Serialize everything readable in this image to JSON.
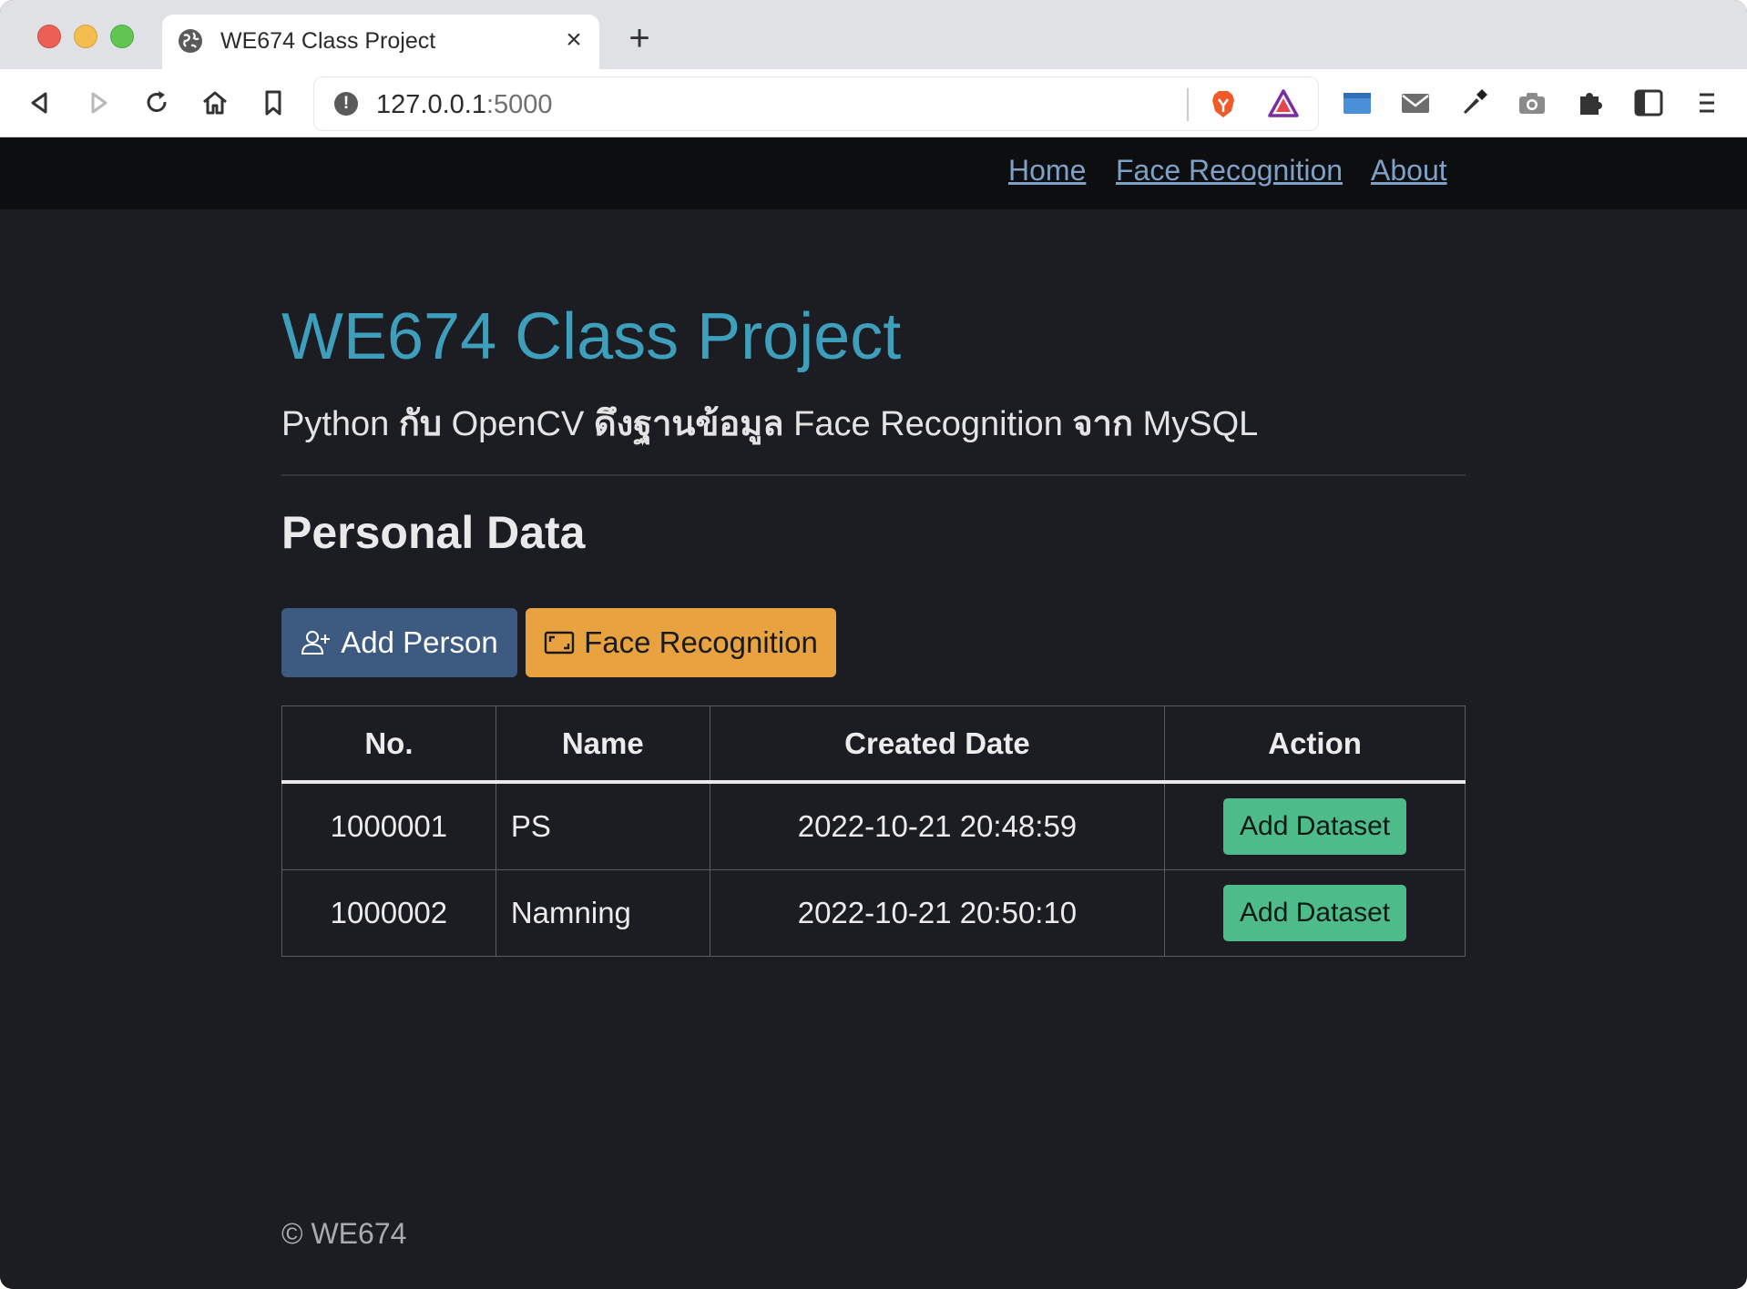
{
  "browser": {
    "tab_title": "WE674 Class Project",
    "tab_close": "×",
    "new_tab": "+",
    "url_host": "127.0.0.1",
    "url_port": ":5000",
    "info_icon": "!",
    "toolbar_icons": [
      "back-icon",
      "forward-icon",
      "reload-icon",
      "home-icon",
      "bookmark-icon",
      "brave-shield-icon",
      "rewards-icon",
      "window-icon",
      "mail-icon",
      "eyedropper-icon",
      "camera-icon",
      "extensions-icon",
      "sidebar-icon",
      "menu-icon"
    ]
  },
  "nav": {
    "links": [
      {
        "label": "Home"
      },
      {
        "label": "Face Recognition"
      },
      {
        "label": "About"
      }
    ]
  },
  "header": {
    "title": "WE674 Class Project",
    "subtitle_parts": [
      "Python ",
      "กับ",
      " OpenCV ",
      "ดึงฐานข้อมูล",
      " Face Recognition ",
      "จาก",
      " MySQL"
    ]
  },
  "section": {
    "title": "Personal Data"
  },
  "buttons": {
    "add_person": "Add Person",
    "face_recognition": "Face Recognition"
  },
  "table": {
    "headers": [
      "No.",
      "Name",
      "Created Date",
      "Action"
    ],
    "rows": [
      {
        "no": "1000001",
        "name": "PS",
        "created": "2022-10-21 20:48:59",
        "action": "Add Dataset"
      },
      {
        "no": "1000002",
        "name": "Namning",
        "created": "2022-10-21 20:50:10",
        "action": "Add Dataset"
      }
    ]
  },
  "footer": {
    "text": "© WE674"
  },
  "colors": {
    "page_bg": "#1b1d22",
    "navbar_bg": "#0d0e10",
    "title": "#3e9fbc",
    "btn_primary": "#3d5a80",
    "btn_warning": "#e8a23f",
    "btn_success": "#4dbb8a",
    "link": "#7fa0c7"
  }
}
